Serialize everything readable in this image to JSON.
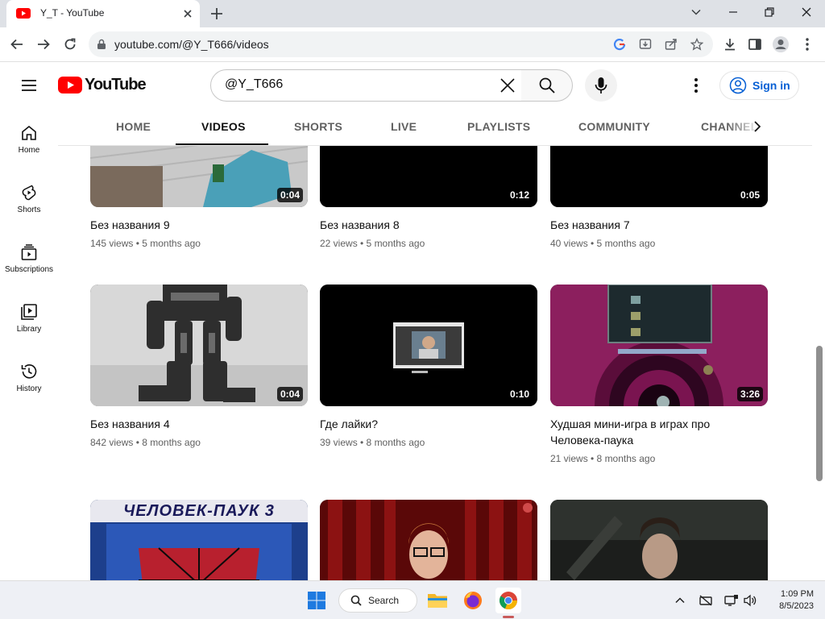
{
  "browser": {
    "tab_title": "Y_T - YouTube",
    "url": "youtube.com/@Y_T666/videos"
  },
  "header": {
    "logo_text": "YouTube",
    "search_value": "@Y_T666",
    "sign_in_label": "Sign in"
  },
  "channel_tabs": [
    "HOME",
    "VIDEOS",
    "SHORTS",
    "LIVE",
    "PLAYLISTS",
    "COMMUNITY",
    "CHANNELS"
  ],
  "active_tab": "VIDEOS",
  "guide": [
    {
      "label": "Home",
      "icon": "home-icon"
    },
    {
      "label": "Shorts",
      "icon": "shorts-icon"
    },
    {
      "label": "Subscriptions",
      "icon": "subscriptions-icon"
    },
    {
      "label": "Library",
      "icon": "library-icon"
    },
    {
      "label": "History",
      "icon": "history-icon"
    }
  ],
  "videos": [
    {
      "title": "Без названия 9",
      "meta": "145 views • 5 months ago",
      "duration": "0:04"
    },
    {
      "title": "Без названия 8",
      "meta": "22 views • 5 months ago",
      "duration": "0:12"
    },
    {
      "title": "Без названия 7",
      "meta": "40 views • 5 months ago",
      "duration": "0:05"
    },
    {
      "title": "Без названия 4",
      "meta": "842 views • 8 months ago",
      "duration": "0:04"
    },
    {
      "title": "Где лайки?",
      "meta": "39 views • 8 months ago",
      "duration": "0:10"
    },
    {
      "title": "Худшая мини-игра в играх про Человека-паука",
      "meta": "21 views • 8 months ago",
      "duration": "3:26"
    },
    {
      "thumb_text": "ЧЕЛОВЕК-ПАУК 3"
    },
    {},
    {}
  ],
  "taskbar": {
    "search_label": "Search",
    "time": "1:09 PM",
    "date": "8/5/2023"
  },
  "colors": {
    "youtube_red": "#ff0000",
    "link_blue": "#065fd4",
    "tab_strip": "#dee1e6"
  }
}
